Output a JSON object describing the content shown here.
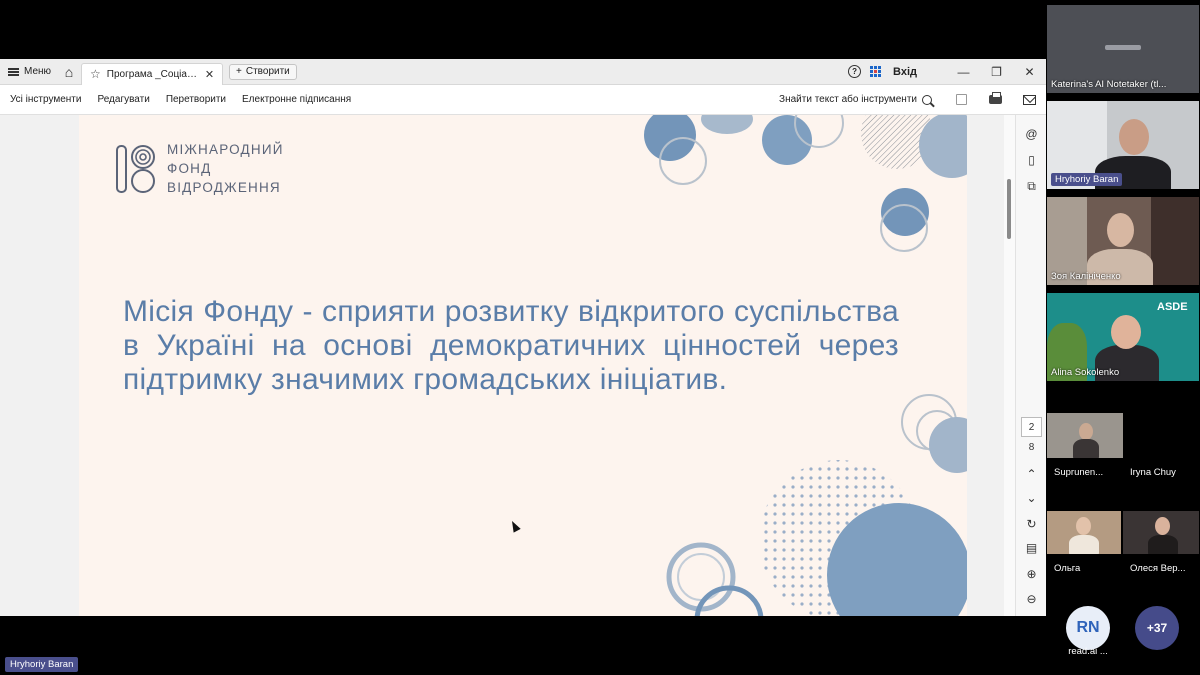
{
  "viewer": {
    "menu_label": "Меню",
    "tab_title": "Програма _Соціальн...",
    "create_label": "Створити",
    "signin_label": "Вхід",
    "tools": [
      "Усі інструменти",
      "Редагувати",
      "Перетворити",
      "Електронне підписання"
    ],
    "find_label": "Знайти текст або інструменти",
    "current_page": "2",
    "total_pages": "8"
  },
  "slide": {
    "logo_lines": [
      "МІЖНАРОДНИЙ",
      "ФОНД",
      "ВІДРОДЖЕННЯ"
    ],
    "mission_text": "Місія Фонду - сприяти розвитку відкритого суспільства в Україні на основі демократичних цінностей через підтримку значимих громадських ініціатив.",
    "colors": {
      "background": "#fdf4ee",
      "text": "#5a7da8",
      "accent": "#7f9fc0"
    }
  },
  "presenter_label": "Hryhoriy Baran",
  "participants": [
    {
      "name": "Katerina's AI Notetaker (tl...",
      "tile_caption": "⁠"
    },
    {
      "name": "Hryhoriy Baran"
    },
    {
      "name": "Зоя Калініченко"
    },
    {
      "name": "Alina Sokolenko",
      "banner": "ASDE"
    },
    {
      "name": "Suprunen..."
    },
    {
      "name": "Iryna Chuy"
    },
    {
      "name": "Ольга"
    },
    {
      "name": "Олеся Вер..."
    }
  ],
  "extra": {
    "initials": "RN",
    "initials_name": "read.ai ...",
    "more_count": "+37"
  }
}
